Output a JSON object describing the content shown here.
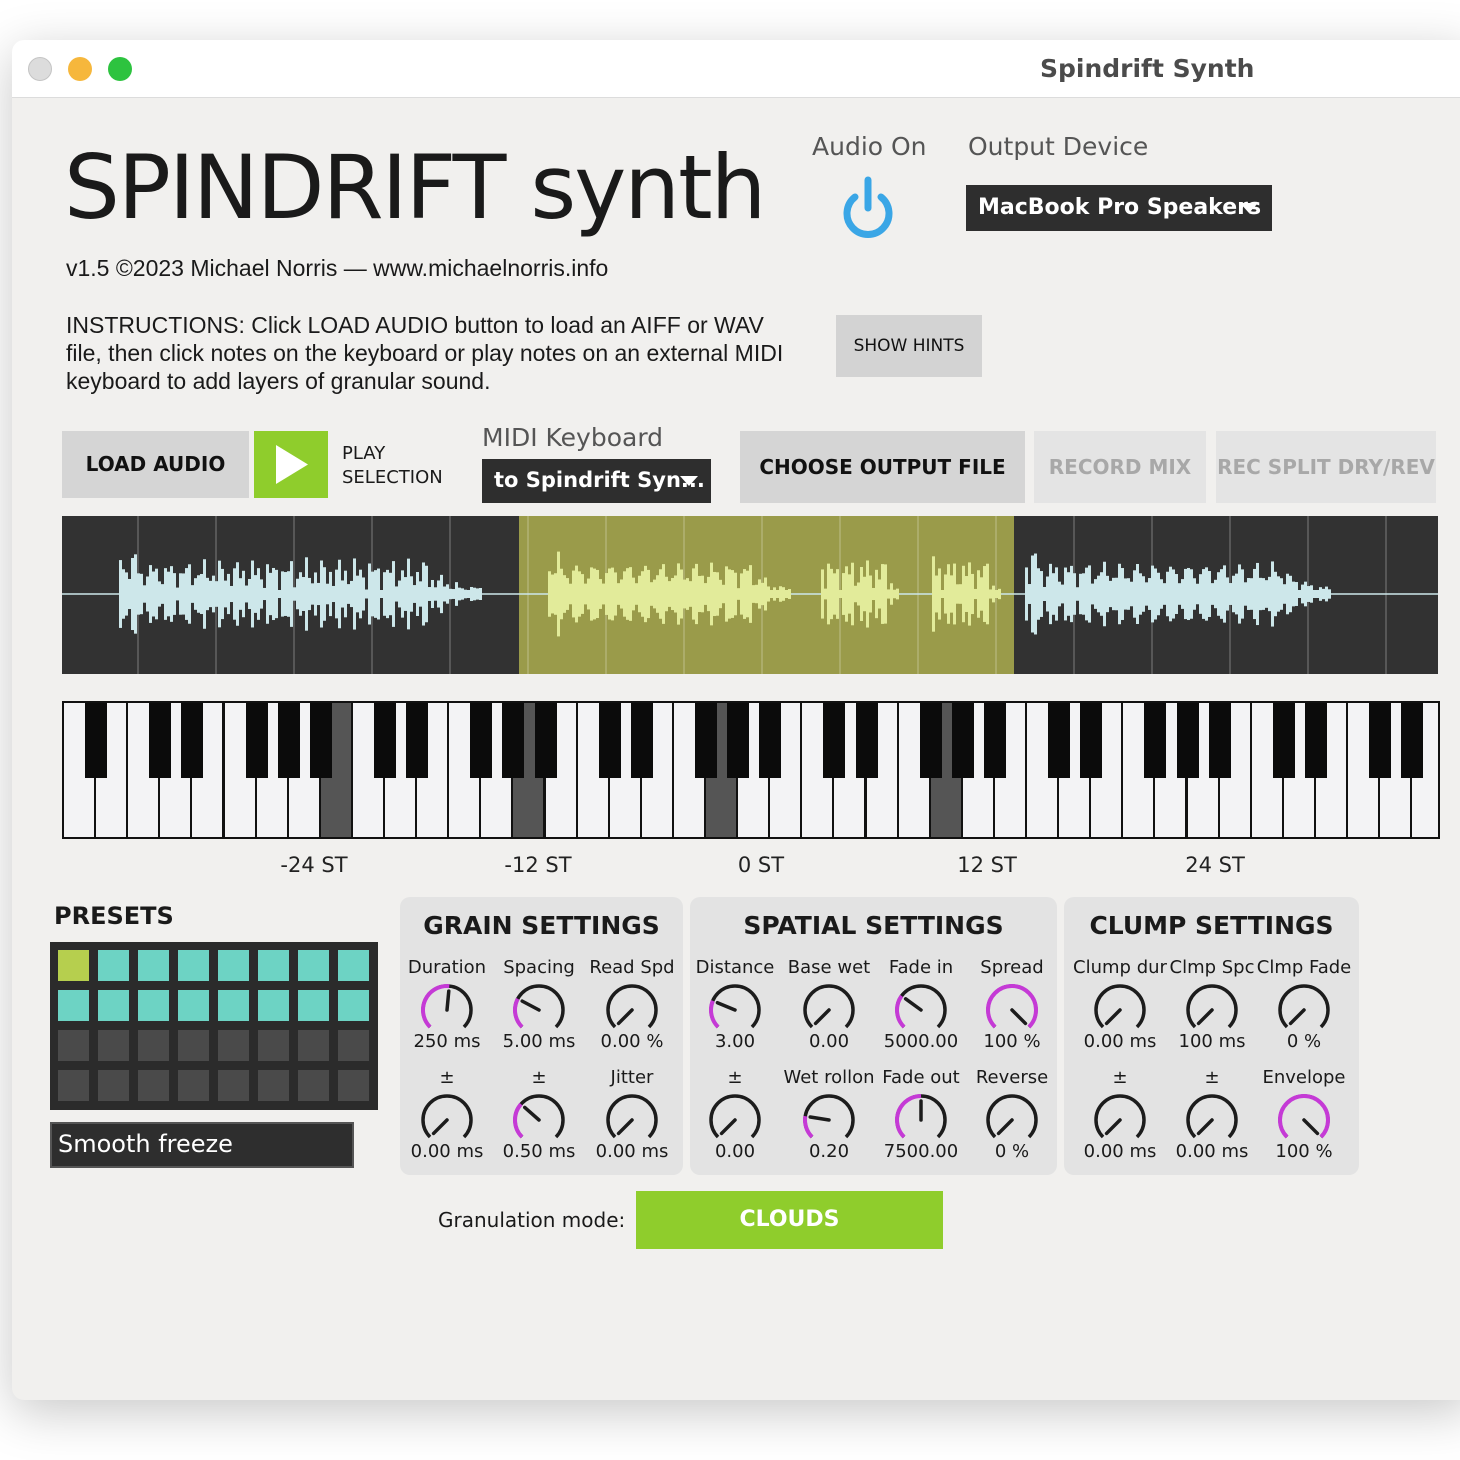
{
  "window": {
    "title": "Spindrift Synth"
  },
  "header": {
    "logo": "SPINDRIFT synth",
    "credits": "v1.5 ©2023 Michael Norris — www.michaelnorris.info",
    "instructions": "INSTRUCTIONS: Click LOAD AUDIO button to load an AIFF or WAV file, then click notes on the keyboard or play notes on an external MIDI keyboard to add layers of granular sound."
  },
  "audio": {
    "label": "Audio On",
    "icon": "power-icon",
    "on": true,
    "color": "#3aa6e6"
  },
  "output_device": {
    "label": "Output Device",
    "value": "MacBook Pro Speakers"
  },
  "hints": {
    "label": "SHOW HINTS"
  },
  "toolbar": {
    "load_audio": "LOAD AUDIO",
    "play_selection_line1": "PLAY",
    "play_selection_line2": "SELECTION",
    "midi_label": "MIDI Keyboard",
    "midi_value": "to Spindrift Syn...",
    "choose_output": "CHOOSE OUTPUT FILE",
    "record_mix": "RECORD MIX",
    "rec_split": "REC SPLIT DRY/REV"
  },
  "waveform": {
    "selection_start": 0.332,
    "selection_end": 0.692,
    "wave_color": "#cde7ea",
    "selection_color": "#9a9b4a"
  },
  "keyboard": {
    "pressed_notes": [
      -25,
      -15,
      -5,
      7
    ],
    "semitone_labels": [
      "-24 ST",
      "-12 ST",
      "0 ST",
      "12 ST",
      "24 ST"
    ]
  },
  "presets": {
    "title": "PRESETS",
    "active_index": 0,
    "filled_count": 16,
    "total": 32,
    "name": "Smooth freeze",
    "colors": {
      "active": "#b6cf4e",
      "filled": "#6dd3c4",
      "empty": "#4a4a4a"
    }
  },
  "grain": {
    "title": "GRAIN SETTINGS",
    "knobs": [
      {
        "label": "Duration",
        "value": "250 ms",
        "level": 0.52
      },
      {
        "label": "Spacing",
        "value": "5.00 ms",
        "level": 0.27
      },
      {
        "label": "Read Spd",
        "value": "0.00 %",
        "level": 0
      },
      {
        "label": "±",
        "value": "0.00 ms",
        "level": 0
      },
      {
        "label": "±",
        "value": "0.50 ms",
        "level": 0.32
      },
      {
        "label": "Jitter",
        "value": "0.00 ms",
        "level": 0
      }
    ]
  },
  "spatial": {
    "title": "SPATIAL SETTINGS",
    "knobs": [
      {
        "label": "Distance",
        "value": "3.00",
        "level": 0.25
      },
      {
        "label": "Base wet",
        "value": "0.00",
        "level": 0
      },
      {
        "label": "Fade in",
        "value": "5000.00",
        "level": 0.3
      },
      {
        "label": "Spread",
        "value": "100 %",
        "level": 1
      },
      {
        "label": "±",
        "value": "0.00",
        "level": 0
      },
      {
        "label": "Wet rollon",
        "value": "0.20",
        "level": 0.2
      },
      {
        "label": "Fade out",
        "value": "7500.00",
        "level": 0.5
      },
      {
        "label": "Reverse",
        "value": "0 %",
        "level": 0
      }
    ]
  },
  "clump": {
    "title": "CLUMP SETTINGS",
    "knobs": [
      {
        "label": "Clump dur",
        "value": "0.00 ms",
        "level": 0
      },
      {
        "label": "Clmp Spc",
        "value": "100 ms",
        "level": 0
      },
      {
        "label": "Clmp Fade",
        "value": "0 %",
        "level": 0
      },
      {
        "label": "±",
        "value": "0.00 ms",
        "level": 0
      },
      {
        "label": "±",
        "value": "0.00 ms",
        "level": 0
      },
      {
        "label": "Envelope",
        "value": "100 %",
        "level": 1
      }
    ]
  },
  "granulation": {
    "label": "Granulation mode:",
    "value": "CLOUDS",
    "color": "#8fcd2c"
  }
}
